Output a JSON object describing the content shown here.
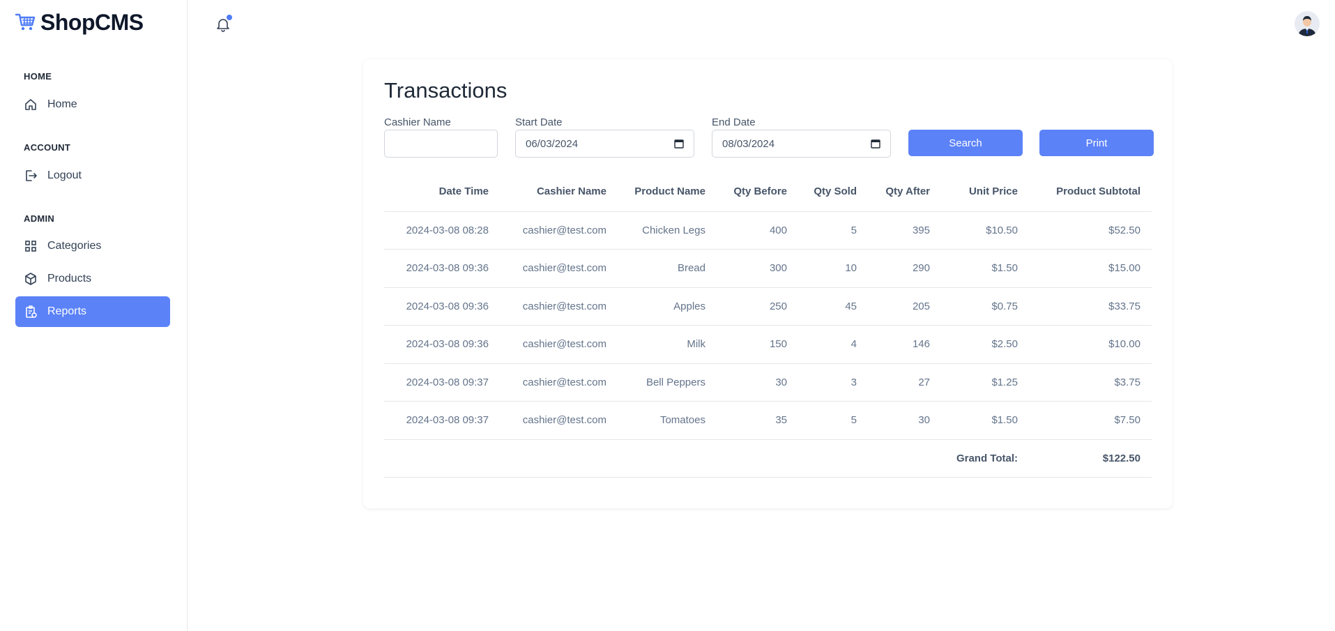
{
  "app": {
    "name": "ShopCMS"
  },
  "sidebar": {
    "sections": [
      {
        "title": "HOME",
        "items": [
          {
            "label": "Home",
            "icon": "home-icon"
          }
        ]
      },
      {
        "title": "ACCOUNT",
        "items": [
          {
            "label": "Logout",
            "icon": "logout-icon"
          }
        ]
      },
      {
        "title": "ADMIN",
        "items": [
          {
            "label": "Categories",
            "icon": "grid-icon"
          },
          {
            "label": "Products",
            "icon": "box-icon"
          },
          {
            "label": "Reports",
            "icon": "report-icon",
            "active": true
          }
        ]
      }
    ]
  },
  "colors": {
    "accent": "#5b82f7",
    "notification_dot": "#4f7cf6"
  },
  "page": {
    "title": "Transactions",
    "filters": {
      "cashier_label": "Cashier Name",
      "cashier_value": "",
      "start_label": "Start Date",
      "start_value": "06/03/2024",
      "end_label": "End Date",
      "end_value": "08/03/2024",
      "search_label": "Search",
      "print_label": "Print"
    },
    "table": {
      "headers": [
        "Date Time",
        "Cashier Name",
        "Product Name",
        "Qty Before",
        "Qty Sold",
        "Qty After",
        "Unit Price",
        "Product Subtotal"
      ],
      "rows": [
        [
          "2024-03-08 08:28",
          "cashier@test.com",
          "Chicken Legs",
          "400",
          "5",
          "395",
          "$10.50",
          "$52.50"
        ],
        [
          "2024-03-08 09:36",
          "cashier@test.com",
          "Bread",
          "300",
          "10",
          "290",
          "$1.50",
          "$15.00"
        ],
        [
          "2024-03-08 09:36",
          "cashier@test.com",
          "Apples",
          "250",
          "45",
          "205",
          "$0.75",
          "$33.75"
        ],
        [
          "2024-03-08 09:36",
          "cashier@test.com",
          "Milk",
          "150",
          "4",
          "146",
          "$2.50",
          "$10.00"
        ],
        [
          "2024-03-08 09:37",
          "cashier@test.com",
          "Bell Peppers",
          "30",
          "3",
          "27",
          "$1.25",
          "$3.75"
        ],
        [
          "2024-03-08 09:37",
          "cashier@test.com",
          "Tomatoes",
          "35",
          "5",
          "30",
          "$1.50",
          "$7.50"
        ]
      ],
      "grand_total_label": "Grand Total:",
      "grand_total_value": "$122.50"
    }
  }
}
